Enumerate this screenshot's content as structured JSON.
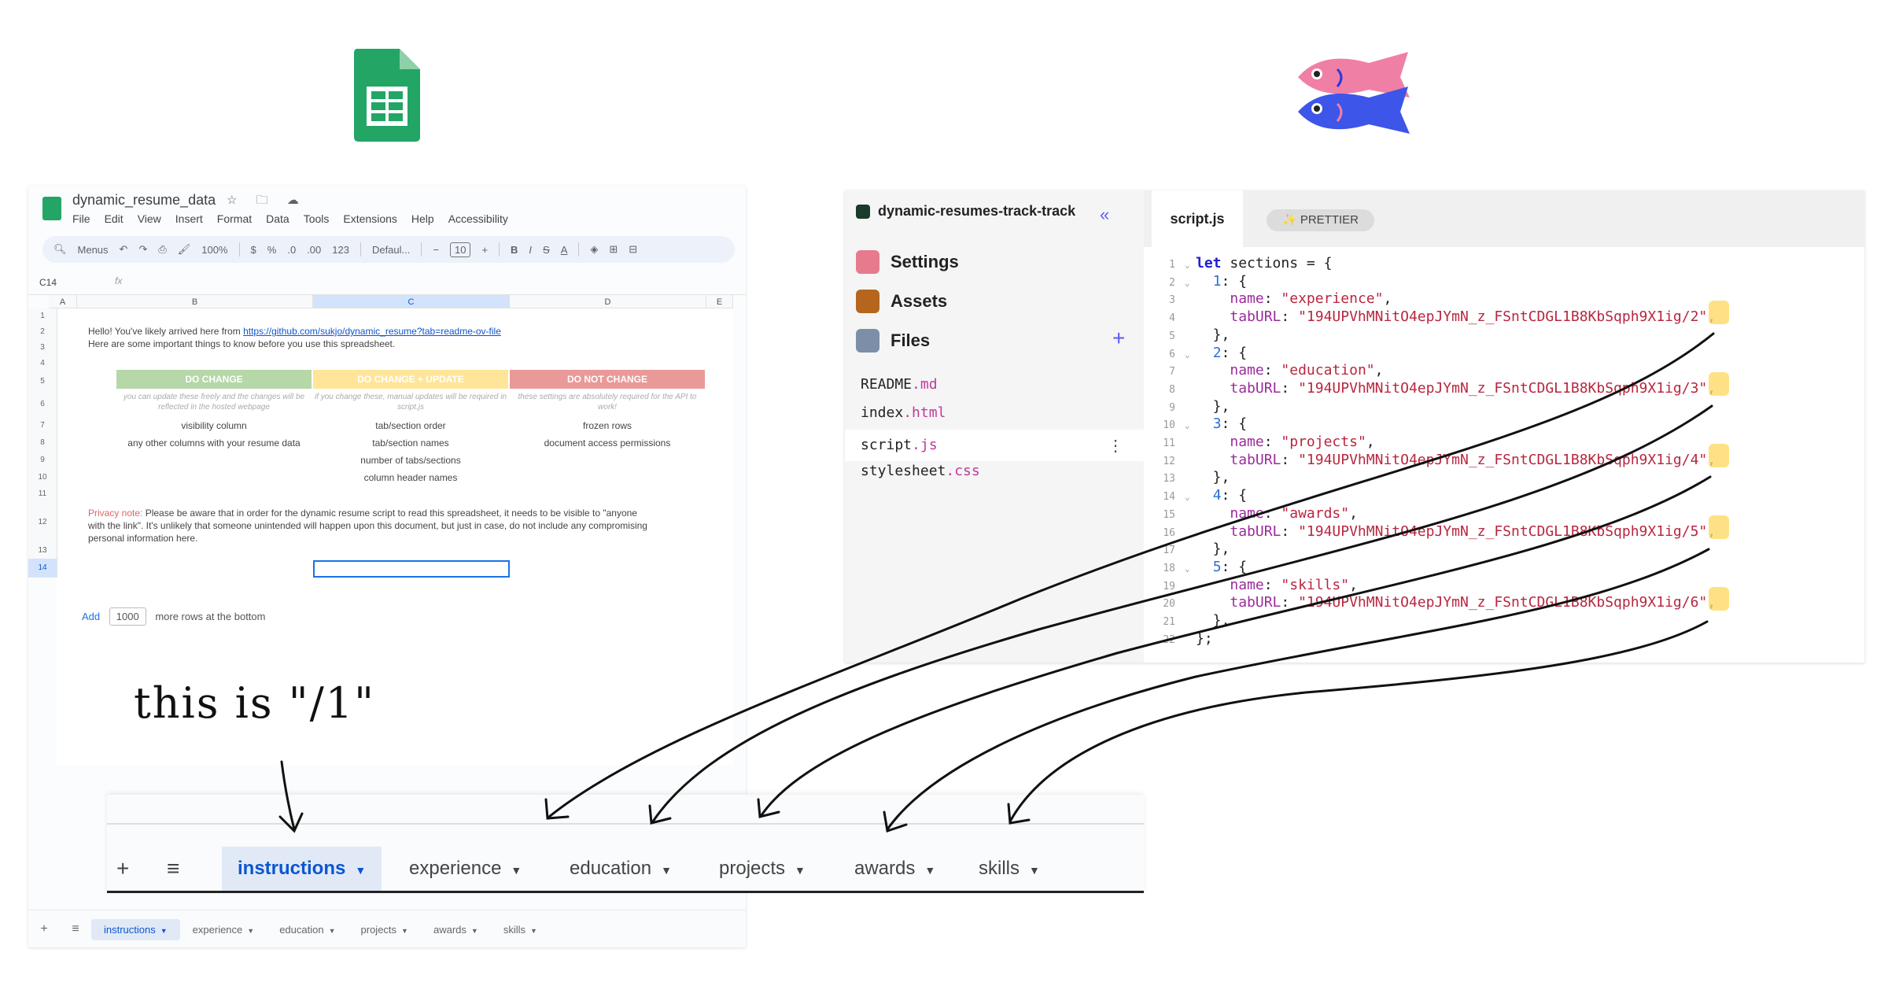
{
  "sheet": {
    "doc_title": "dynamic_resume_data",
    "title_icons": "☆ 🗀 ☁",
    "menu": [
      "File",
      "Edit",
      "View",
      "Insert",
      "Format",
      "Data",
      "Tools",
      "Extensions",
      "Help",
      "Accessibility"
    ],
    "toolbar": {
      "menus": "Menus",
      "zoom": "100%",
      "currency": "$",
      "percent": "%",
      "dec_dec": ".0",
      "inc_dec": ".00",
      "num": "123",
      "font": "Defaul...",
      "minus": "−",
      "font_size": "10",
      "plus": "+",
      "bold": "B",
      "italic": "I",
      "strike": "S",
      "textcolor": "A"
    },
    "name_box": "C14",
    "fx": "fx",
    "columns": [
      "A",
      "B",
      "C",
      "D",
      "E"
    ],
    "rows": [
      "1",
      "2",
      "3",
      "4",
      "5",
      "6",
      "7",
      "8",
      "9",
      "10",
      "11",
      "12",
      "13",
      "14"
    ],
    "intro_line1_prefix": "Hello! You've likely arrived here from ",
    "intro_link": "https://github.com/sukjo/dynamic_resume?tab=readme-ov-file",
    "intro_line2": "Here are some important things to know before you use this spreadsheet.",
    "table": {
      "headers": [
        "DO CHANGE",
        "DO CHANGE + UPDATE",
        "DO NOT CHANGE"
      ],
      "header_colors": [
        "#b6d7a8",
        "#ffe599",
        "#ea9999"
      ],
      "sub": [
        "you can update these freely and the changes will be reflected in the hosted webpage",
        "if you change these, manual updates will be required in script.js",
        "these settings are absolutely required for the API to work!"
      ],
      "rows": [
        [
          "visibility column",
          "tab/section order",
          "frozen rows"
        ],
        [
          "any other columns with your resume data",
          "tab/section names",
          "document access permissions"
        ],
        [
          "",
          "number of tabs/sections",
          ""
        ],
        [
          "",
          "column header names",
          ""
        ]
      ]
    },
    "privacy_label": "Privacy note:",
    "privacy_text": " Please be aware that in order for the dynamic resume script to read this spreadsheet, it needs to be visible to \"anyone with the link\". It's unlikely that someone unintended will happen upon this document, but just in case, do not include any compromising personal information here.",
    "add_rows": {
      "add": "Add",
      "count": "1000",
      "suffix": "more rows at the bottom"
    },
    "tabs": [
      "instructions",
      "experience",
      "education",
      "projects",
      "awards",
      "skills"
    ]
  },
  "editor": {
    "project": "dynamic-resumes-track-track",
    "collapse": "«",
    "nav": [
      "Settings",
      "Assets",
      "Files"
    ],
    "add_file": "+",
    "files": [
      {
        "name": "README",
        "ext": ".md"
      },
      {
        "name": "index",
        "ext": ".html"
      },
      {
        "name": "script",
        "ext": ".js"
      },
      {
        "name": "stylesheet",
        "ext": ".css"
      }
    ],
    "kebab": "⋮",
    "tab": "script.js",
    "prettier": "✨ PRETTIER",
    "code": [
      {
        "n": "1",
        "fold": "⌄",
        "t": [
          [
            "kw",
            "let "
          ],
          [
            "pl",
            "sections = {"
          ]
        ]
      },
      {
        "n": "2",
        "fold": "⌄",
        "t": [
          [
            "pl",
            "  "
          ],
          [
            "nm",
            "1"
          ],
          [
            "pl",
            ": {"
          ]
        ]
      },
      {
        "n": "3",
        "fold": "",
        "t": [
          [
            "pl",
            "    "
          ],
          [
            "key",
            "name"
          ],
          [
            "pl",
            ": "
          ],
          [
            "str",
            "\"experience\""
          ],
          [
            "pl",
            ","
          ]
        ]
      },
      {
        "n": "4",
        "fold": "",
        "t": [
          [
            "pl",
            "    "
          ],
          [
            "key",
            "tabURL"
          ],
          [
            "pl",
            ": "
          ],
          [
            "str",
            "\"194UPVhMNitO4epJYmN_z_FSntCDGL1B8KbSqph9X1ig/2\""
          ],
          [
            "pl",
            ","
          ]
        ]
      },
      {
        "n": "5",
        "fold": "",
        "t": [
          [
            "pl",
            "  },"
          ]
        ]
      },
      {
        "n": "6",
        "fold": "⌄",
        "t": [
          [
            "pl",
            "  "
          ],
          [
            "nm",
            "2"
          ],
          [
            "pl",
            ": {"
          ]
        ]
      },
      {
        "n": "7",
        "fold": "",
        "t": [
          [
            "pl",
            "    "
          ],
          [
            "key",
            "name"
          ],
          [
            "pl",
            ": "
          ],
          [
            "str",
            "\"education\""
          ],
          [
            "pl",
            ","
          ]
        ]
      },
      {
        "n": "8",
        "fold": "",
        "t": [
          [
            "pl",
            "    "
          ],
          [
            "key",
            "tabURL"
          ],
          [
            "pl",
            ": "
          ],
          [
            "str",
            "\"194UPVhMNitO4epJYmN_z_FSntCDGL1B8KbSqph9X1ig/3\""
          ],
          [
            "pl",
            ","
          ]
        ]
      },
      {
        "n": "9",
        "fold": "",
        "t": [
          [
            "pl",
            "  },"
          ]
        ]
      },
      {
        "n": "10",
        "fold": "⌄",
        "t": [
          [
            "pl",
            "  "
          ],
          [
            "nm",
            "3"
          ],
          [
            "pl",
            ": {"
          ]
        ]
      },
      {
        "n": "11",
        "fold": "",
        "t": [
          [
            "pl",
            "    "
          ],
          [
            "key",
            "name"
          ],
          [
            "pl",
            ": "
          ],
          [
            "str",
            "\"projects\""
          ],
          [
            "pl",
            ","
          ]
        ]
      },
      {
        "n": "12",
        "fold": "",
        "t": [
          [
            "pl",
            "    "
          ],
          [
            "key",
            "tabURL"
          ],
          [
            "pl",
            ": "
          ],
          [
            "str",
            "\"194UPVhMNitO4epJYmN_z_FSntCDGL1B8KbSqph9X1ig/4\""
          ],
          [
            "pl",
            ","
          ]
        ]
      },
      {
        "n": "13",
        "fold": "",
        "t": [
          [
            "pl",
            "  },"
          ]
        ]
      },
      {
        "n": "14",
        "fold": "⌄",
        "t": [
          [
            "pl",
            "  "
          ],
          [
            "nm",
            "4"
          ],
          [
            "pl",
            ": {"
          ]
        ]
      },
      {
        "n": "15",
        "fold": "",
        "t": [
          [
            "pl",
            "    "
          ],
          [
            "key",
            "name"
          ],
          [
            "pl",
            ": "
          ],
          [
            "str",
            "\"awards\""
          ],
          [
            "pl",
            ","
          ]
        ]
      },
      {
        "n": "16",
        "fold": "",
        "t": [
          [
            "pl",
            "    "
          ],
          [
            "key",
            "tabURL"
          ],
          [
            "pl",
            ": "
          ],
          [
            "str",
            "\"194UPVhMNitO4epJYmN_z_FSntCDGL1B8KbSqph9X1ig/5\""
          ],
          [
            "pl",
            ","
          ]
        ]
      },
      {
        "n": "17",
        "fold": "",
        "t": [
          [
            "pl",
            "  },"
          ]
        ]
      },
      {
        "n": "18",
        "fold": "⌄",
        "t": [
          [
            "pl",
            "  "
          ],
          [
            "nm",
            "5"
          ],
          [
            "pl",
            ": {"
          ]
        ]
      },
      {
        "n": "19",
        "fold": "",
        "t": [
          [
            "pl",
            "    "
          ],
          [
            "key",
            "name"
          ],
          [
            "pl",
            ": "
          ],
          [
            "str",
            "\"skills\""
          ],
          [
            "pl",
            ","
          ]
        ]
      },
      {
        "n": "20",
        "fold": "",
        "t": [
          [
            "pl",
            "    "
          ],
          [
            "key",
            "tabURL"
          ],
          [
            "pl",
            ": "
          ],
          [
            "str",
            "\"194UPVhMNitO4epJYmN_z_FSntCDGL1B8KbSqph9X1ig/6\""
          ],
          [
            "pl",
            ","
          ]
        ]
      },
      {
        "n": "21",
        "fold": "",
        "t": [
          [
            "pl",
            "  },"
          ]
        ]
      },
      {
        "n": "22",
        "fold": "",
        "t": [
          [
            "pl",
            "};"
          ]
        ]
      }
    ]
  },
  "zoom_tabs": {
    "add": "+",
    "list": "≡",
    "tabs": [
      "instructions",
      "experience",
      "education",
      "projects",
      "awards",
      "skills"
    ]
  },
  "hand_note": "this is \"/1\"",
  "icons": {
    "sheets_logo": "google-sheets-logo",
    "glitch_logo": "glitch-fish-logo"
  },
  "colors": {
    "sheets_green": "#23a566",
    "tab_active_bg": "#e1e9f7",
    "tab_active_fg": "#0b57d0",
    "highlight": "#ffd966"
  }
}
